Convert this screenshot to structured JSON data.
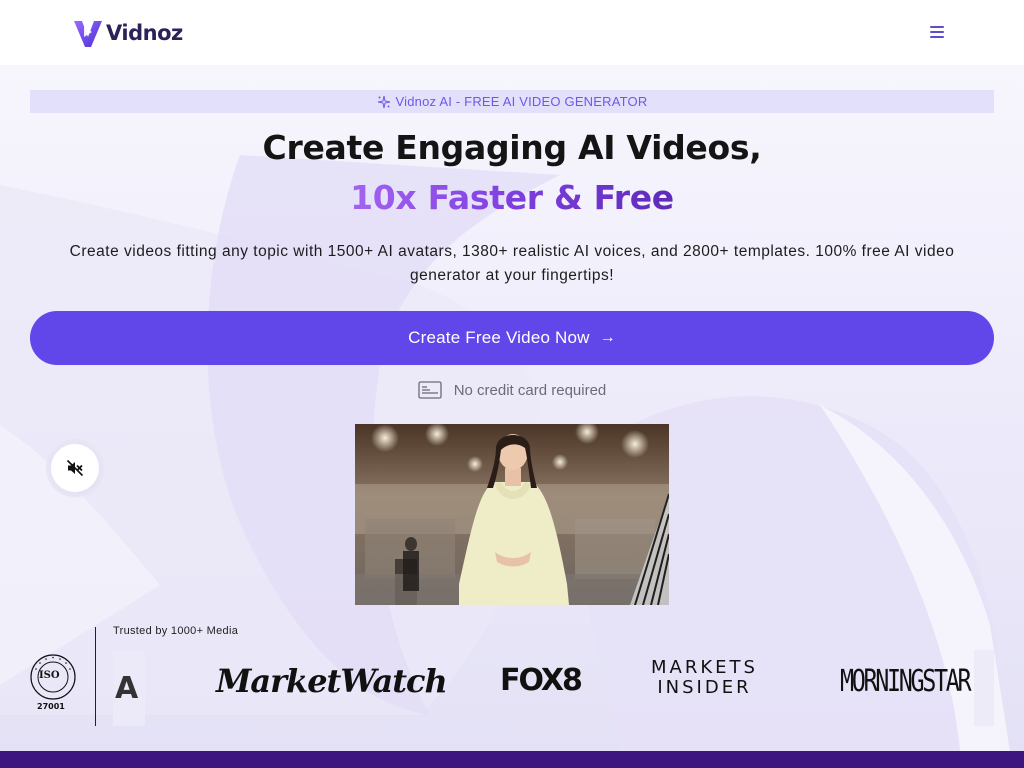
{
  "header": {
    "logo_text": "Vidnoz",
    "menu_icon": "hamburger-menu-icon"
  },
  "hero": {
    "badge": "Vidnoz AI - FREE AI VIDEO GENERATOR",
    "title_line1": "Create Engaging AI Videos,",
    "title_line2": "10x Faster & Free",
    "subtitle": "Create videos fitting any topic with 1500+ AI avatars, 1380+ realistic AI voices, and 2800+ templates. 100% free AI video generator at your fingertips!",
    "cta_label": "Create Free Video Now",
    "cta_arrow": "→",
    "no_card": "No credit card required",
    "colors": {
      "accent": "#6146ea",
      "gradient_start": "#a463f2",
      "gradient_end": "#5e2bb8"
    }
  },
  "video": {
    "mute_icon": "muted-speaker-icon"
  },
  "trusted": {
    "label": "Trusted by 1000+ Media",
    "iso_text": "ISO",
    "iso_number": "27001",
    "logos": {
      "partial": "A",
      "marketwatch": "MarketWatch",
      "fox8": "FOX8",
      "markets_insider_1": "MARKETS",
      "markets_insider_2": "INSIDER",
      "morningstar": "MORNINGSTAR"
    }
  }
}
